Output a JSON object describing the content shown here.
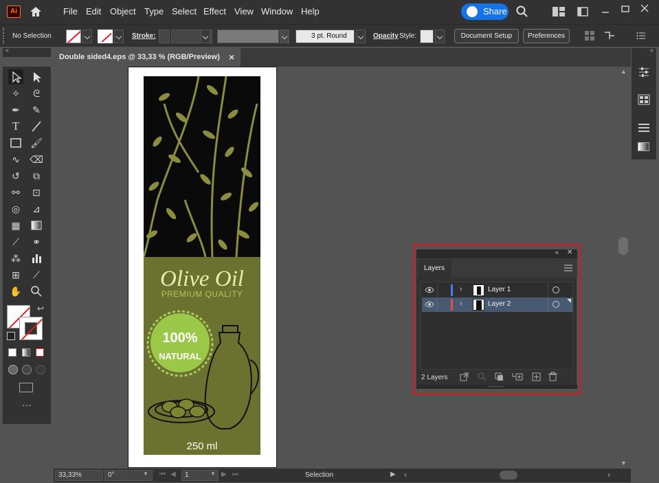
{
  "app": {
    "logo": "Ai",
    "menus": [
      "File",
      "Edit",
      "Object",
      "Type",
      "Select",
      "Effect",
      "View",
      "Window",
      "Help"
    ],
    "share_label": "Share"
  },
  "controlbar": {
    "selection_label": "No Selection",
    "stroke_label": "Stroke:",
    "brush_label": "3 pt. Round",
    "opacity_label": "Opacity",
    "style_label": "Style:",
    "doc_setup_label": "Document Setup",
    "prefs_label": "Preferences"
  },
  "document": {
    "tab_title": "Double sided4.eps @ 33,33 % (RGB/Preview)",
    "close_glyph": "×"
  },
  "artwork": {
    "title": "Olive Oil",
    "subtitle": "PREMIUM QUALITY",
    "badge_percent": "100%",
    "badge_text": "NATURAL",
    "volume": "250 ml",
    "colors": {
      "dark_bg": "#0a0a0a",
      "olive_bg": "#6b712e",
      "leaf": "#8c8d3e",
      "badge": "#9cc84a"
    }
  },
  "layers_panel": {
    "tab_label": "Layers",
    "rows": [
      {
        "name": "Layer 1",
        "color": "#4a7be6",
        "selected": false
      },
      {
        "name": "Layer 2",
        "color": "#e05050",
        "selected": true
      }
    ],
    "count_label": "2 Layers"
  },
  "statusbar": {
    "zoom": "33,33%",
    "rotation": "0°",
    "artboard": "1",
    "tool_label": "Selection"
  },
  "icons": [
    "home-icon",
    "search-icon",
    "arrange-icon",
    "minimize-icon",
    "maximize-icon",
    "close-icon",
    "eye-icon",
    "chevron-icon",
    "trash-icon"
  ]
}
